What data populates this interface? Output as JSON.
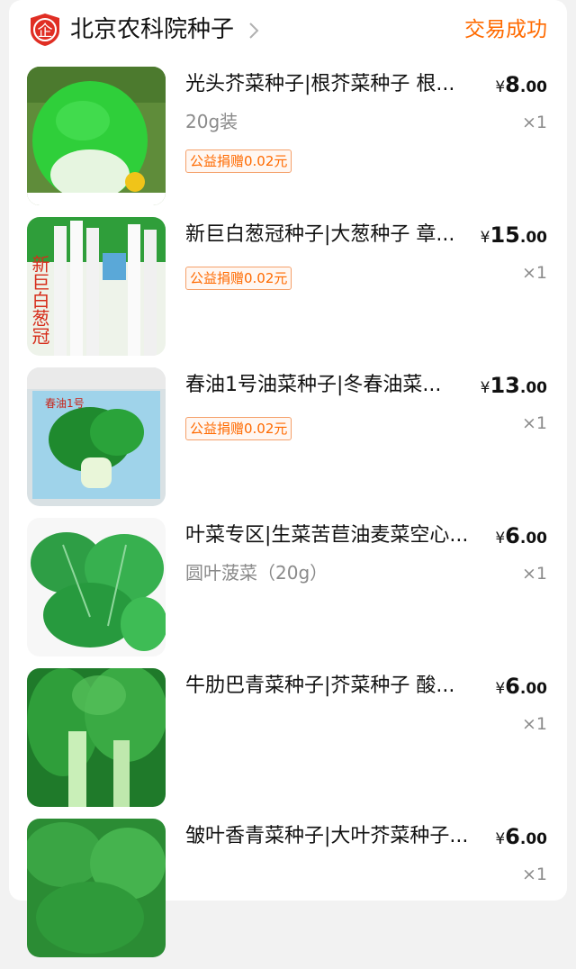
{
  "shop": {
    "logo_text": "企",
    "name": "北京农科院种子",
    "status": "交易成功"
  },
  "items": [
    {
      "title": "光头芥菜种子|根芥菜种子 根...",
      "price_symbol": "¥",
      "price_int": "8",
      "price_dec": ".00",
      "spec": "20g装",
      "qty": "×1",
      "donation": "公益捐赠0.02元",
      "image": "round-green-turnip"
    },
    {
      "title": "新巨白葱冠种子|大葱种子 章...",
      "price_symbol": "¥",
      "price_int": "15",
      "price_dec": ".00",
      "spec": "",
      "qty": "×1",
      "donation": "公益捐赠0.02元",
      "image": "scallion-seed-packet",
      "packet_text": "新巨白葱冠"
    },
    {
      "title": "春油1号油菜种子|冬春油菜...",
      "price_symbol": "¥",
      "price_int": "13",
      "price_dec": ".00",
      "spec": "",
      "qty": "×1",
      "donation": "公益捐赠0.02元",
      "image": "bok-choy-seed-packet",
      "packet_text": "春油1号"
    },
    {
      "title": "叶菜专区|生菜苦苣油麦菜空心...",
      "price_symbol": "¥",
      "price_int": "6",
      "price_dec": ".00",
      "spec": "圆叶菠菜（20g）",
      "qty": "×1",
      "donation": "",
      "image": "spinach-leaves"
    },
    {
      "title": "牛肋巴青菜种子|芥菜种子 酸...",
      "price_symbol": "¥",
      "price_int": "6",
      "price_dec": ".00",
      "spec": "",
      "qty": "×1",
      "donation": "",
      "image": "mustard-greens"
    },
    {
      "title": "皱叶香青菜种子|大叶芥菜种子...",
      "price_symbol": "¥",
      "price_int": "6",
      "price_dec": ".00",
      "spec": "",
      "qty": "×1",
      "donation": "",
      "image": "curly-mustard-leaves"
    }
  ],
  "colors": {
    "accent": "#ff6a00",
    "logo_red": "#e02e24"
  }
}
